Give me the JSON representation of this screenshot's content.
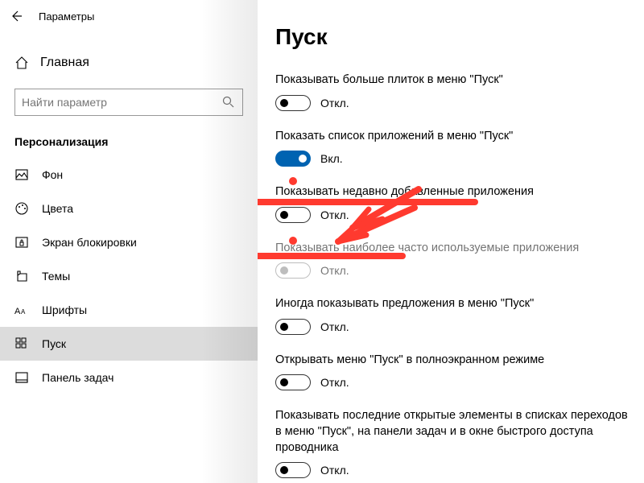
{
  "window": {
    "title": "Параметры"
  },
  "sidebar": {
    "home": "Главная",
    "search_placeholder": "Найти параметр",
    "category": "Персонализация",
    "items": [
      {
        "label": "Фон",
        "icon": "image"
      },
      {
        "label": "Цвета",
        "icon": "palette"
      },
      {
        "label": "Экран блокировки",
        "icon": "lock"
      },
      {
        "label": "Темы",
        "icon": "themes"
      },
      {
        "label": "Шрифты",
        "icon": "fonts"
      },
      {
        "label": "Пуск",
        "icon": "start",
        "active": true
      },
      {
        "label": "Панель задач",
        "icon": "taskbar"
      }
    ]
  },
  "page": {
    "title": "Пуск"
  },
  "settings": [
    {
      "label": "Показывать больше плиток в меню \"Пуск\"",
      "on": false,
      "text": "Откл.",
      "disabled": false
    },
    {
      "label": "Показать список приложений в меню \"Пуск\"",
      "on": true,
      "text": "Вкл.",
      "disabled": false
    },
    {
      "label": "Показывать недавно добавленные приложения",
      "on": false,
      "text": "Откл.",
      "disabled": false
    },
    {
      "label": "Показывать наиболее часто используемые приложения",
      "on": false,
      "text": "Откл.",
      "disabled": true
    },
    {
      "label": "Иногда показывать предложения в меню \"Пуск\"",
      "on": false,
      "text": "Откл.",
      "disabled": false
    },
    {
      "label": "Открывать меню \"Пуск\" в полноэкранном режиме",
      "on": false,
      "text": "Откл.",
      "disabled": false
    },
    {
      "label": "Показывать последние открытые элементы в списках переходов в меню \"Пуск\", на панели задач и в окне быстрого доступа проводника",
      "on": false,
      "text": "Откл.",
      "disabled": false
    }
  ],
  "annotation": {
    "color": "#ff3a2f"
  }
}
